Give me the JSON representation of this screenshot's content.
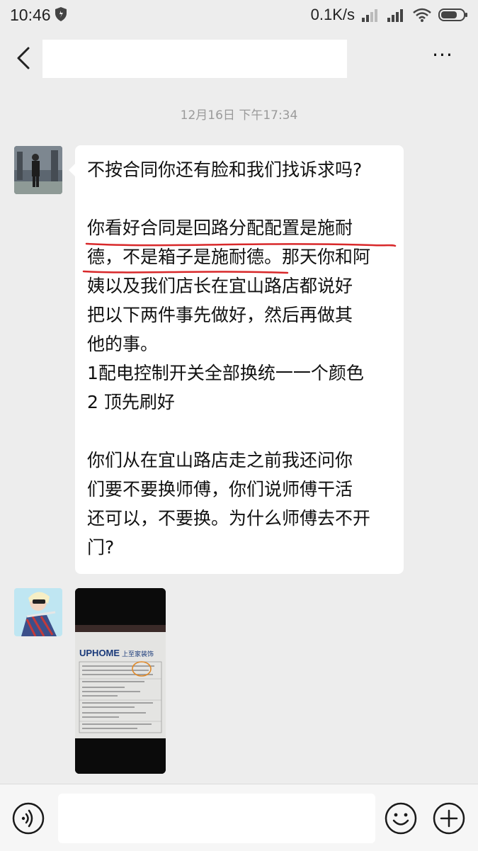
{
  "status_bar": {
    "time": "10:46",
    "net_speed": "0.1K/s"
  },
  "header": {
    "title": "",
    "more_label": "···"
  },
  "chat": {
    "timestamp": "12月16日 下午17:34",
    "message_lines": [
      "不按合同你还有脸和我们找诉求吗?",
      "",
      "你看好合同是回路分配配置是施耐",
      "德，不是箱子是施耐德。那天你和阿",
      "姨以及我们店长在宜山路店都说好",
      "把以下两件事先做好，然后再做其",
      "他的事。",
      "1配电控制开关全部换统一一个颜色",
      "2 顶先刷好",
      "",
      "你们从在宜山路店走之前我还问你",
      "们要不要换师傅，你们说师傅干活",
      "还可以，不要换。为什么师傅去不开",
      "门?"
    ],
    "image_message": {
      "brand": "UPHOME",
      "brand_cn": "上至家装饰"
    }
  },
  "colors": {
    "underline": "#d8282a",
    "background": "#ededed",
    "bubble": "#ffffff"
  }
}
